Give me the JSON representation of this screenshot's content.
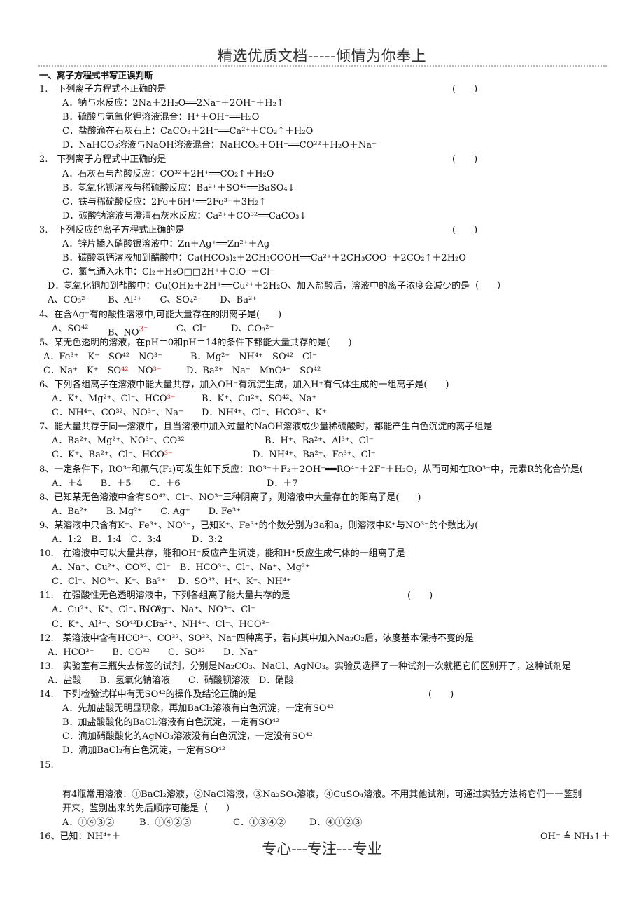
{
  "header": {
    "title": "精选优质文档-----倾情为你奉上"
  },
  "footer": {
    "text": "专心---专注---专业"
  },
  "section": {
    "title": "一、离子方程式书写正误判断"
  },
  "bracket": "(　　)",
  "q1": {
    "stem": "1.　下列离子方程式不正确的是",
    "A": "A．钠与水反应：2Na＋2H₂O══2Na⁺＋2OH⁻＋H₂↑",
    "B": "B．硫酸与氢氧化钾溶液混合：H⁺＋OH⁻══H₂O",
    "C": "C．盐酸滴在石灰石上：CaCO₃＋2H⁺══Ca²⁺＋CO₂↑＋H₂O",
    "D": "D．NaHCO₃溶液与NaOH溶液混合：NaHCO₃＋OH⁻══CO³²＋H₂O＋Na⁺"
  },
  "q2": {
    "stem": "2.　下列离子方程式中正确的是",
    "A": "A．石灰石与盐酸反应：CO³²＋2H⁺══CO₂↑＋H₂O",
    "B": "B．氢氧化钡溶液与稀硫酸反应：Ba²⁺＋SO⁴²══BaSO₄↓",
    "C": "C．铁与稀硫酸反应：2Fe＋6H⁺══2Fe³⁺＋3H₂↑",
    "D": "D．碳酸钠溶液与澄清石灰水反应：Ca²⁺＋CO³²══CaCO₃↓"
  },
  "q3": {
    "stem": "3.　下列反应的离子方程式正确的是",
    "A": "A．锌片插入硝酸银溶液中：Zn＋Ag⁺══Zn²⁺＋Ag",
    "B": "B．碳酸氢钙溶液加到醋酸中：Ca(HCO₃)₂＋2CH₃COOH══Ca²⁺＋2CH₃COO⁻＋2CO₂↑＋2H₂O",
    "C": "C．氯气通入水中：Cl₂＋H₂O□□2H⁺＋ClO⁻＋Cl⁻",
    "D": "D．氢氧化铜加到盐酸中：Cu(OH)₂＋2H⁺══Cu²⁺＋2H₂O、加入盐酸后，溶液中的离子浓度会减少的是（　　）",
    "options": "A、CO₃²⁻　　B、Al³⁺　　C、SO₄²⁻　　D、Ba²⁺"
  },
  "q4": {
    "stem": "4、在含Ag⁺有的酸性溶液中,可能大量存在的阴离子是(　　)",
    "A": "A、SO⁴²",
    "B_prefix": "B、NO",
    "B_sup": "3⁻",
    "C": "C、Cl⁻",
    "D": "D、CO₃²⁻"
  },
  "q5": {
    "stem": "5、某无色透明的溶液，在pH＝0和pH＝14的条件下都能大量共存的是(　　)",
    "A": "A．Fe³⁺　K⁺　SO⁴²　NO³⁻",
    "B": "B．Mg²⁺　NH⁴⁺　SO⁴²　Cl⁻",
    "C_prefix": "C．Na⁺　K⁺　SO",
    "C_sup1": "⁴²",
    "C_mid": "　NO",
    "C_sup2": "³⁻",
    "D": "D．Ba²⁺　Na⁺　MnO⁴⁻　SO⁴²"
  },
  "q6": {
    "stem": "6、下列各组离子在溶液中能大量共存，加入OH⁻有沉淀生成，加入H⁺有气体生成的一组离子是(　　)",
    "A_prefix": "A．K⁺、Mg²⁺、Cl⁻、HCO",
    "A_sup": "³⁻",
    "B": "B．K⁺、Cu²⁺、SO⁴²、Na⁺",
    "C": "C．NH⁴⁺、CO³²、NO³⁻、Na⁺",
    "D": "D．NH⁴⁺、Cl⁻、HCO³⁻、K⁺"
  },
  "q7": {
    "stem": "7、能大量共存于同一溶液中，且当溶液中加入过量的NaOH溶液或少量稀硫酸时，都能产生白色沉淀的离子组是",
    "A": "A．Ba²⁺、Mg²⁺、NO³⁻、CO³²",
    "B": "B．H⁺、Ba²⁺、Al³⁺、Cl⁻",
    "C_prefix": "C．K⁺、Ba²⁺、Cl⁻、HCO",
    "C_sup": "³⁻",
    "D": "D．NH⁴⁺、Ba²⁺、Fe³⁺、Cl⁻"
  },
  "q8a": {
    "stem": "8、一定条件下，RO³⁻和氟气(F₂)可发生如下反应：RO³⁻＋F₂＋2OH⁻══RO⁴⁻＋2F⁻＋H₂O，从而可知在RO³⁻中，元素R的化合价是(",
    "A": "A．＋4　　B．＋5　　C．＋6",
    "D": "D．＋7"
  },
  "q8b": {
    "stem": "8、已知某无色溶液中含有SO⁴²、Cl⁻、NO³⁻三种阴离子，则溶液中大量存在的阳离子是(　　)",
    "options": "A．Ba²⁺　　B. Mg²⁺　　C. Ag⁺　　D. Fe³⁺"
  },
  "q9": {
    "stem": "9、某溶液中只含有K⁺、Fe³⁺、NO³⁻，已知K⁺、Fe³⁺的个数分别为3a和a，则溶液中K⁺与NO³⁻的个数比为(",
    "A": "A．1:2　B．1:4　C．3:4",
    "D": "D．3:2"
  },
  "q10": {
    "stem": "10.　在溶液中可以大量共存，能和OH⁻反应产生沉淀，能和H⁺反应生成气体的一组离子是",
    "AB": "A．Na⁺、Cu²⁺、CO³²、Cl⁻　B．HCO³⁻、Cl⁻、Na⁺、Mg²⁺",
    "CD": "C．Cl⁻、NO³⁻、K⁺、Ba²⁺　 D．SO³²、H⁺、K⁺、NH⁴⁺"
  },
  "q11": {
    "stem": "11.　在强酸性无色透明溶液中，下列各组离子能大量共存的是",
    "A": "A．Cu²⁺、K⁺、Cl⁻、NO³⁻",
    "B": "B．Ag⁺、Na⁺、NO³⁻、Cl⁻",
    "C": "C．K⁺、Al³⁺、SO⁴²、Cl⁻",
    "D": "D．Ba²⁺、NH⁴⁺、Cl⁻、HCO³⁻"
  },
  "q12": {
    "stem": "12.　某溶液中含有HCO³⁻、CO³²、SO³²、Na⁺四种离子，若向其中加入Na₂O₂后，浓度基本保持不变的是",
    "options": "A．HCO³⁻　　B．CO³²　　C．SO³²　　D．Na⁺"
  },
  "q13": {
    "stem": "13.　实验室有三瓶失去标签的试剂，分别是Na₂CO₃、NaCl、AgNO₃。实验员选择了一种试剂一次就把它们区别开了，这种试剂是",
    "options": "A．盐酸　　B．氢氧化钠溶液　　C．硝酸钡溶液　D．硝酸"
  },
  "q14": {
    "stem": "14.　下列检验试样中有无SO⁴²的操作及结论正确的是",
    "A": "A．先加盐酸无明显现象，再加BaCl₂溶液有白色沉淀，一定有SO⁴²",
    "B": "B．加盐酸酸化的BaCl₂溶液有白色沉淀，一定有SO⁴²",
    "C": "C．滴加硝酸酸化的AgNO₃溶液没有白色沉淀，一定没有SO⁴²",
    "D": "D．滴加BaCl₂有白色沉淀，一定有SO⁴²"
  },
  "q15": {
    "number": "15.",
    "stem1": "有4瓶常用溶液：①BaCl₂溶液，②NaCl溶液，③Na₂SO₄溶液，④CuSO₄溶液。不用其他试剂，可通过实验方法将它们一一鉴别",
    "stem2": "开来，鉴别出来的先后顺序可能是（　　）",
    "A": "A．①④③②",
    "B": "B．①④②③",
    "C": "C．①③④②",
    "D": "D．④①②③"
  },
  "q16": {
    "left": "16、已知：NH⁴⁺＋",
    "right": "OH⁻ ≜ NH₃↑＋"
  }
}
